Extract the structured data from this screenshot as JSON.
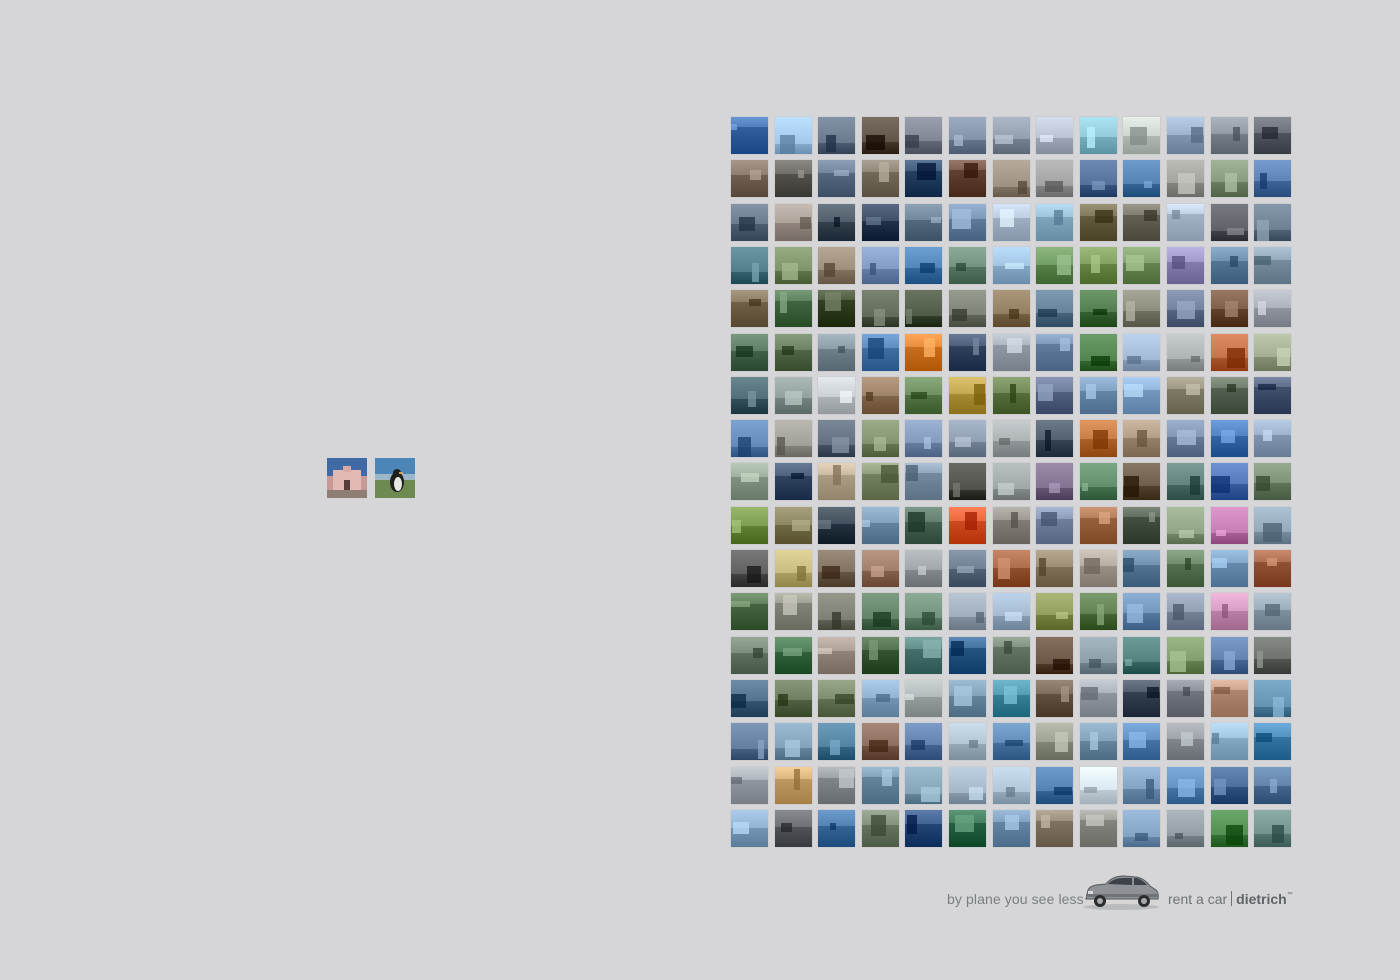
{
  "tagline": "by plane you see less",
  "brand": {
    "prefix": "rent a car",
    "name": "dietrich",
    "trademark": "™"
  },
  "icons": {
    "car": "car-icon"
  },
  "left_thumbnails": [
    {
      "name": "pink-house-building",
      "sky": "#3f6aa6",
      "ground": "#c89a96",
      "accent": "#e7c4c0"
    },
    {
      "name": "penguin",
      "sky": "#4c86b8",
      "ground": "#6d8a53",
      "accent": "#1e1e1e"
    }
  ],
  "grid": {
    "rows": 17,
    "cols": 13,
    "palette_rows": [
      [
        "#3c6aa8",
        "#8fb3d6",
        "#55657a",
        "#4d4034",
        "#6c7280",
        "#6f7e95",
        "#7f8a9a",
        "#a7b0c0",
        "#7fb7c7",
        "#b9c3bb",
        "#8aa0b8",
        "#7f8793",
        "#5a5e66"
      ],
      [
        "#7a6a5e",
        "#5d5b56",
        "#60728a",
        "#7d7466",
        "#2f4a6b",
        "#6b4b3c",
        "#8a7d6d",
        "#8e8e8e",
        "#3f5d86",
        "#3f6f9c",
        "#8f8f8a",
        "#74876b",
        "#4a6fa1"
      ],
      [
        "#59677b",
        "#9a8f86",
        "#3d4b58",
        "#2b3c54",
        "#5f7389",
        "#6a84a6",
        "#a9b9cd",
        "#8ab0c8",
        "#6e6649",
        "#6e6b5e",
        "#aebcd0",
        "#4a4d53",
        "#596b7f"
      ],
      [
        "#3f6b78",
        "#6b7f55",
        "#8a7a68",
        "#6c88b0",
        "#3f73a6",
        "#5f7e6b",
        "#8fb1d0",
        "#5f8a54",
        "#6f8e4d",
        "#6f8e5a",
        "#8d86b7",
        "#5f7f9f",
        "#7f97a8"
      ],
      [
        "#7a6b52",
        "#4a6f4a",
        "#3d4a2e",
        "#4d5544",
        "#3b4633",
        "#6b6f63",
        "#7f6a4e",
        "#506e86",
        "#3f6b3b",
        "#7a7a6a",
        "#5f6f8a",
        "#6b4b36",
        "#9a9ea8"
      ],
      [
        "#4b6b52",
        "#5a6f4f",
        "#7a8a95",
        "#4a79ae",
        "#d37a2a",
        "#3b4d66",
        "#9aa3ad",
        "#6b86a6",
        "#3f6f3b",
        "#8fa6c2",
        "#9aa0a0",
        "#b35e36",
        "#8f9a7f"
      ],
      [
        "#3d5a64",
        "#7f8d8a",
        "#b7bcc0",
        "#8a6f55",
        "#5d7d4f",
        "#b0953e",
        "#5f7846",
        "#5a6a88",
        "#6f8fb0",
        "#7fa3c8",
        "#8a8570",
        "#5f6b5a",
        "#4a5a77"
      ],
      [
        "#4f76a5",
        "#8d8b84",
        "#4d5b6d",
        "#6f7f5b",
        "#6f86a6",
        "#7c8a9f",
        "#9a9fa2",
        "#3f4d5d",
        "#b46b33",
        "#a08a74",
        "#6f84a0",
        "#3f6fae",
        "#8aa0b8"
      ],
      [
        "#8b9c8a",
        "#3a4e6a",
        "#b8a78f",
        "#7d8b6a",
        "#7f94a8",
        "#3d3d38",
        "#8c9493",
        "#6f5f7f",
        "#4e7a5a",
        "#5a4b37",
        "#4f6f6a",
        "#4066a8",
        "#6a7e66"
      ],
      [
        "#6b8a3e",
        "#7a7350",
        "#2f3d4a",
        "#6e8da8",
        "#4f6b5b",
        "#d8542a",
        "#8c8680",
        "#7a8aa6",
        "#a06b46",
        "#4e5a4a",
        "#7c9070",
        "#b06aa0",
        "#7f96a8"
      ],
      [
        "#4c4c4c",
        "#b5a86d",
        "#6f5d4d",
        "#8d6a55",
        "#8c9296",
        "#5c6c80",
        "#9a5a3a",
        "#8a7a62",
        "#a39a90",
        "#5e7f9c",
        "#5f7a5a",
        "#6f94b8",
        "#9d5c3f"
      ],
      [
        "#4f6f4a",
        "#8d8e82",
        "#6a6b5f",
        "#4f6f55",
        "#5f7f6b",
        "#8c9aa8",
        "#8fa6bd",
        "#7d8a4a",
        "#4e6e3f",
        "#5f82a8",
        "#7f8ba0",
        "#c58ab0",
        "#8a9aa8"
      ],
      [
        "#6a7a6a",
        "#3d6b45",
        "#9b8c84",
        "#3f5f3b",
        "#4f7a76",
        "#2f5f8a",
        "#6f7f6f",
        "#5a4232",
        "#7a8a95",
        "#3f6f6b",
        "#6f8a5a",
        "#4f6f9a",
        "#5a5e5a"
      ],
      [
        "#3f5f7a",
        "#5a6a4a",
        "#6a7a5b",
        "#7f9fbf",
        "#9ea6a8",
        "#6f8fa6",
        "#3f8aa0",
        "#6b5a4a",
        "#9aa0a8",
        "#3f4a5a",
        "#7a7f88",
        "#b9917a",
        "#4f7f9c"
      ],
      [
        "#4f6a8a",
        "#6f8fa6",
        "#3f6f8f",
        "#7a5a4a",
        "#4f6f9a",
        "#9fb2c0",
        "#4f7aa6",
        "#8a8f80",
        "#6f8fa6",
        "#4f7fb0",
        "#8a9096",
        "#8fb3cc",
        "#3f7fae"
      ],
      [
        "#9ba1a8",
        "#c9a36b",
        "#8a8f93",
        "#6f8fa6",
        "#6f8fa3",
        "#8fa3b5",
        "#9cb3c6",
        "#3f6f9f",
        "#c7d3dd",
        "#6f8fb0",
        "#4f7fae",
        "#3a5a8a",
        "#4f7096"
      ],
      [
        "#7f9fbf",
        "#5a5e62",
        "#3f6fa0",
        "#6f7f6a",
        "#2f4f7f",
        "#2f6a4a",
        "#6f8fae",
        "#8a7c6a",
        "#8f8f8a",
        "#6f8fb0",
        "#7f8a90",
        "#3f7a3f",
        "#5f7f7a"
      ]
    ]
  }
}
